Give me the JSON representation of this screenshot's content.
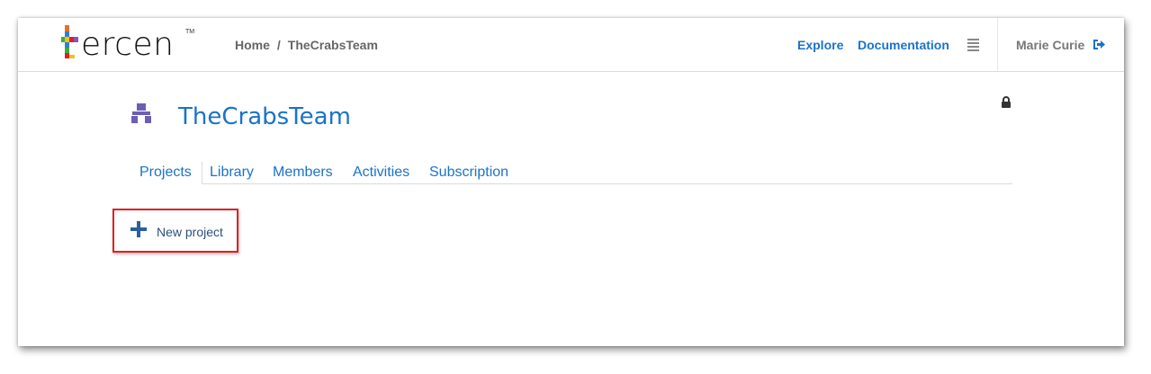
{
  "brand": {
    "logo_text": "ercen",
    "logo_first_letter": "t",
    "trademark": "TM"
  },
  "breadcrumb": {
    "home": "Home",
    "separator": "/",
    "current": "TheCrabsTeam"
  },
  "nav": {
    "explore": "Explore",
    "documentation": "Documentation"
  },
  "user": {
    "name": "Marie Curie"
  },
  "team": {
    "title": "TheCrabsTeam"
  },
  "tabs": [
    {
      "label": "Projects",
      "active": true
    },
    {
      "label": "Library",
      "active": false
    },
    {
      "label": "Members",
      "active": false
    },
    {
      "label": "Activities",
      "active": false
    },
    {
      "label": "Subscription",
      "active": false
    }
  ],
  "actions": {
    "new_project": "New project"
  },
  "colors": {
    "link": "#1a73c8",
    "team_icon": "#6b5fb3",
    "highlight_border": "#e02020",
    "plus": "#2b5f9e"
  },
  "icons": {
    "menu": "hamburger-icon",
    "logout": "sign-out-icon",
    "lock": "lock-icon",
    "team": "team-icon",
    "add": "plus-icon"
  }
}
